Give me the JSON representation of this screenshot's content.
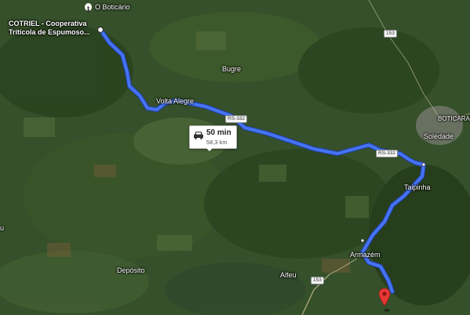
{
  "origin": {
    "line1": "COTRIEL - Cooperativa",
    "line2": "Tritícola de Espumoso..."
  },
  "poi_label": "O Boticário",
  "places": {
    "bugre": "Bugre",
    "volta_alegre": "Volta Alegre",
    "soledade": "Soledade",
    "boticaria": "BOTICARAI",
    "taipinha": "Taipinha",
    "armazem": "Armazém",
    "alfeu": "Alfeu",
    "deposito": "Depósito",
    "edge_left": "u"
  },
  "roads": {
    "rs332_a": "RS-332",
    "rs332_b": "RS-332",
    "br153_top": "153",
    "br153_bottom": "153"
  },
  "route_info": {
    "duration": "50 min",
    "distance": "58,3 km"
  },
  "icons": {
    "poi": "person-marker-icon",
    "car": "car-icon",
    "destination": "destination-pin-icon"
  },
  "colors": {
    "route": "#3f6ff0",
    "route_edge": "#1f3fa8",
    "pin": "#e53935"
  }
}
